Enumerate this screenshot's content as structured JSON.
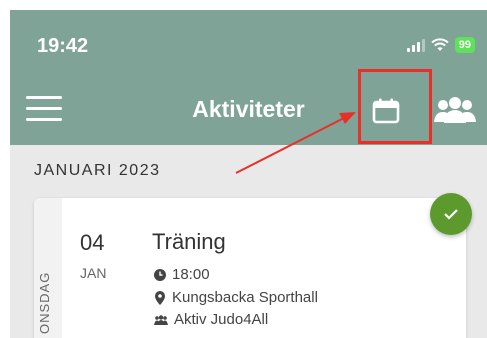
{
  "status": {
    "time": "19:42",
    "battery": "99"
  },
  "header": {
    "title": "Aktiviteter"
  },
  "section": {
    "month": "JANUARI 2023"
  },
  "activity": {
    "weekday": "ONSDAG",
    "day": "04",
    "month": "JAN",
    "title": "Träning",
    "time": "18:00",
    "location": "Kungsbacka Sporthall",
    "group": "Aktiv Judo4All"
  },
  "colors": {
    "header": "#7fa497",
    "highlight": "#e8302a",
    "check": "#5c9a2e"
  }
}
